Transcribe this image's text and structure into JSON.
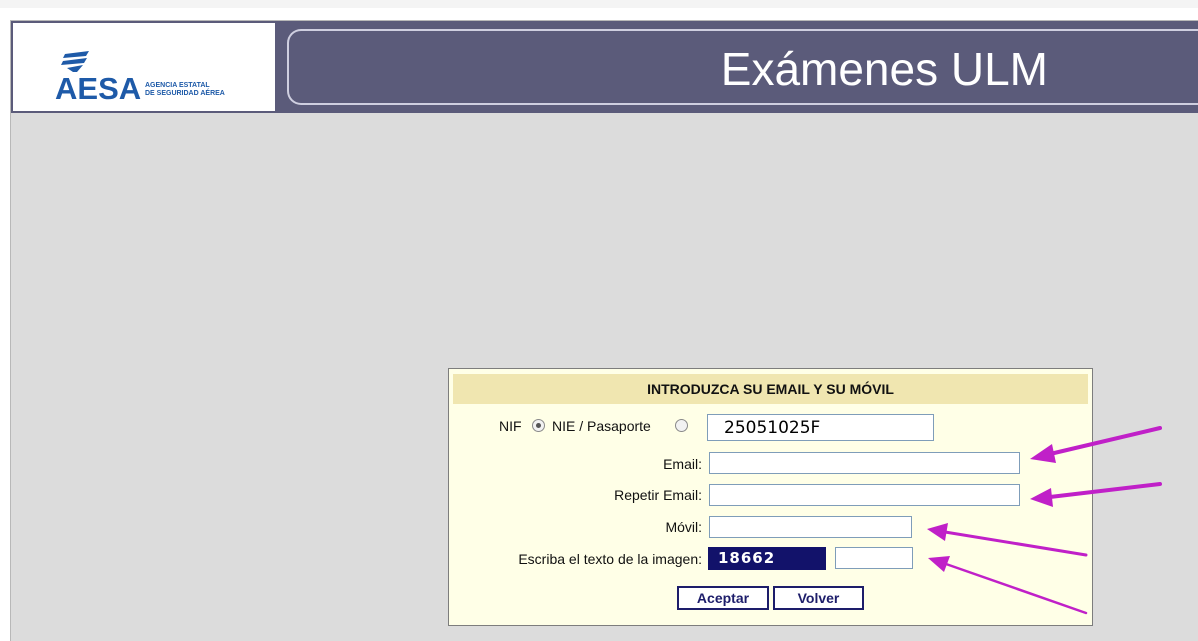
{
  "header": {
    "logo_text": "AESA",
    "logo_subtitle_line1": "AGENCIA ESTATAL",
    "logo_subtitle_line2": "DE SEGURIDAD AÉREA",
    "title": "Exámenes ULM"
  },
  "form": {
    "heading": "INTRODUZCA SU EMAIL Y SU MÓVIL",
    "nif_label": "NIF",
    "nie_label": "NIE / Pasaporte",
    "selected_document": "NIF",
    "document_value": "25051025F",
    "email_label": "Email:",
    "email_value": "",
    "repeat_email_label": "Repetir Email:",
    "repeat_email_value": "",
    "mobile_label": "Móvil:",
    "mobile_value": "",
    "captcha_label": "Escriba el texto de la imagen:",
    "captcha_text": "18662",
    "captcha_value": "",
    "accept_label": "Aceptar",
    "back_label": "Volver"
  },
  "colors": {
    "header_bg": "#5b5b7a",
    "brand_blue": "#1e5aa8",
    "form_bg": "#ffffe7",
    "form_header_bg": "#f0e6b0",
    "captcha_bg": "#12126a",
    "annotation_arrow": "#c020c8"
  }
}
